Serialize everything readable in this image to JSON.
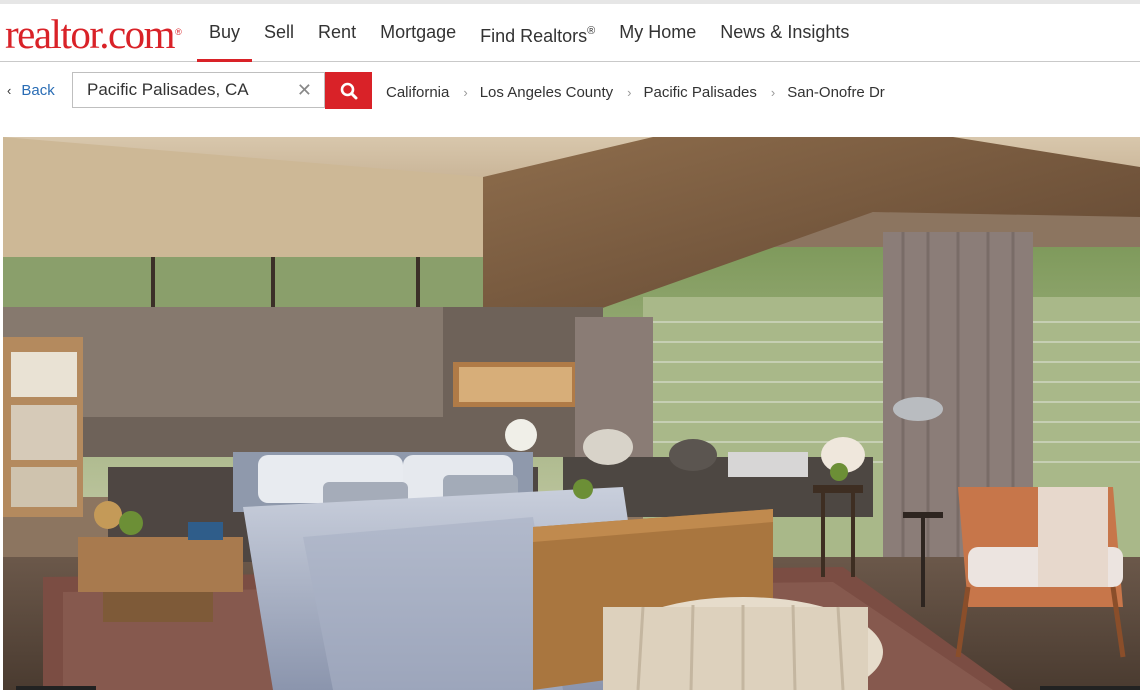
{
  "brand": {
    "logo_text": "realtor.com",
    "logo_mark": "®",
    "brand_color": "#d92228"
  },
  "nav": {
    "items": [
      {
        "label": "Buy",
        "active": true
      },
      {
        "label": "Sell"
      },
      {
        "label": "Rent"
      },
      {
        "label": "Mortgage"
      },
      {
        "label": "Find Realtors",
        "mark": "®"
      },
      {
        "label": "My Home"
      },
      {
        "label": "News & Insights"
      }
    ]
  },
  "search": {
    "back_label": "Back",
    "value": "Pacific Palisades, CA",
    "clear_icon": "close-icon",
    "button_icon": "search-icon"
  },
  "breadcrumb": {
    "items": [
      "California",
      "Los Angeles County",
      "Pacific Palisades",
      "San-Onofre Dr"
    ]
  },
  "listing_photo": {
    "subject": "bedroom-photo"
  }
}
